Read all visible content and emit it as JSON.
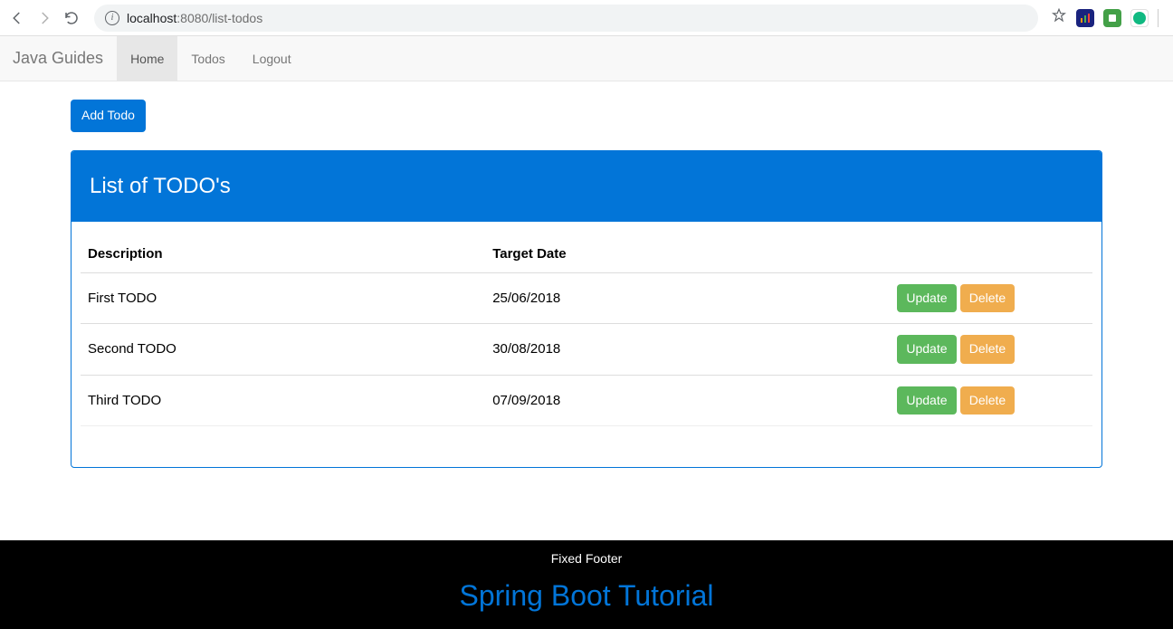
{
  "browser": {
    "url_host": "localhost",
    "url_rest": ":8080/list-todos"
  },
  "navbar": {
    "brand": "Java Guides",
    "links": [
      {
        "label": "Home",
        "active": true
      },
      {
        "label": "Todos",
        "active": false
      },
      {
        "label": "Logout",
        "active": false
      }
    ]
  },
  "buttons": {
    "add_todo": "Add Todo",
    "update": "Update",
    "delete": "Delete"
  },
  "panel": {
    "title": "List of TODO's",
    "columns": {
      "description": "Description",
      "target_date": "Target Date"
    }
  },
  "todos": [
    {
      "description": "First TODO",
      "target_date": "25/06/2018"
    },
    {
      "description": "Second TODO",
      "target_date": "30/08/2018"
    },
    {
      "description": "Third TODO",
      "target_date": "07/09/2018"
    }
  ],
  "footer": {
    "label": "Fixed Footer",
    "title": "Spring Boot Tutorial"
  }
}
